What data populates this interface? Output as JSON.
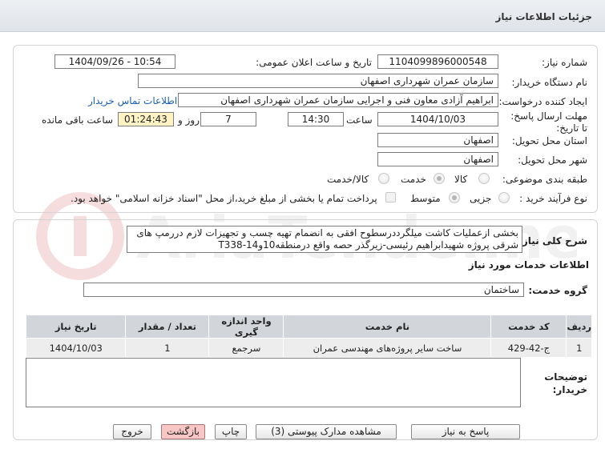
{
  "header": {
    "title": "جزئیات اطلاعات نیاز"
  },
  "fields": {
    "need_number_label": "شماره نیاز:",
    "need_number": "1104099896000548",
    "announce_label": "تاریخ و ساعت اعلان عمومی:",
    "announce_value": "1404/09/26 - 10:54",
    "buyer_org_label": "نام دستگاه خریدار:",
    "buyer_org": "سازمان عمران شهرداری اصفهان",
    "creator_label": "ایجاد کننده درخواست:",
    "creator": "ابراهیم آزادی معاون فنی و اجرایی سازمان عمران شهرداری اصفهان",
    "contact_link": "اطلاعات تماس خریدار",
    "deadline_label": "مهلت ارسال پاسخ: تا تاریخ:",
    "deadline_date": "1404/10/03",
    "time_label": "ساعت",
    "deadline_time": "14:30",
    "days_value": "7",
    "days_label": "روز و",
    "remaining_time": "01:24:43",
    "remaining_label": "ساعت باقی مانده",
    "province_label": "استان محل تحویل:",
    "province": "اصفهان",
    "city_label": "شهر محل تحویل:",
    "city": "اصفهان",
    "category_label": "طبقه بندی موضوعی:",
    "category_options": [
      "کالا",
      "خدمت",
      "کالا/خدمت"
    ],
    "process_label": "نوع فرآیند خرید :",
    "process_options": [
      "جزیی",
      "متوسط"
    ],
    "payment_note": "پرداخت تمام یا بخشی از مبلغ خرید،از محل \"اسناد خزانه اسلامی\" خواهد بود."
  },
  "description": {
    "label": "شرح کلی نیاز:",
    "text": "بخشی ازعملیات کاشت میلگرددرسطوح افقی به انضمام تهیه چسب و تجهیزات لازم دررمپ های شرقی پروژه شهیدابراهیم رئیسی-زیرگذر حصه واقع درمنطقه10و14-T338"
  },
  "services": {
    "section_title": "اطلاعات خدمات مورد نیاز",
    "group_label": "گروه خدمت:",
    "group_value": "ساختمان",
    "headers": [
      "ردیف",
      "کد خدمت",
      "نام خدمت",
      "واحد اندازه گیری",
      "تعداد / مقدار",
      "تاریخ نیاز"
    ],
    "rows": [
      [
        "1",
        "ج-42-429",
        "ساخت سایر پروژه‌های مهندسی عمران",
        "سرجمع",
        "1",
        "1404/10/03"
      ]
    ]
  },
  "buyer_notes": {
    "label": "توضیحات خریدار:",
    "value": ""
  },
  "buttons": {
    "reply": "پاسخ به نیاز",
    "view_docs": "مشاهده مدارک پیوستی (3)",
    "print": "چاپ",
    "back": "بازگشت",
    "exit": "خروج"
  },
  "colors": {
    "header_bg": "#e4e8ec",
    "timer_bg": "#fff3c4",
    "link": "#1a5fb4",
    "back_button": "#f9c6c6"
  }
}
